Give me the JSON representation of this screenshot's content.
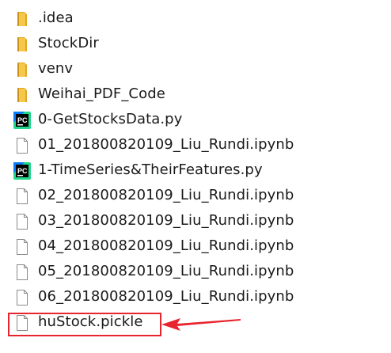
{
  "files": [
    {
      "name": ".idea",
      "type": "folder",
      "icon": "folder-icon"
    },
    {
      "name": "StockDir",
      "type": "folder",
      "icon": "folder-icon"
    },
    {
      "name": "venv",
      "type": "folder",
      "icon": "folder-icon"
    },
    {
      "name": "Weihai_PDF_Code",
      "type": "folder",
      "icon": "folder-icon"
    },
    {
      "name": "0-GetStocksData.py",
      "type": "python",
      "icon": "pycharm-icon"
    },
    {
      "name": "01_201800820109_Liu_Rundi.ipynb",
      "type": "file",
      "icon": "file-icon"
    },
    {
      "name": "1-TimeSeries&TheirFeatures.py",
      "type": "python",
      "icon": "pycharm-icon"
    },
    {
      "name": "02_201800820109_Liu_Rundi.ipynb",
      "type": "file",
      "icon": "file-icon"
    },
    {
      "name": "03_201800820109_Liu_Rundi.ipynb",
      "type": "file",
      "icon": "file-icon"
    },
    {
      "name": "04_201800820109_Liu_Rundi.ipynb",
      "type": "file",
      "icon": "file-icon"
    },
    {
      "name": "05_201800820109_Liu_Rundi.ipynb",
      "type": "file",
      "icon": "file-icon"
    },
    {
      "name": "06_201800820109_Liu_Rundi.ipynb",
      "type": "file",
      "icon": "file-icon"
    },
    {
      "name": "huStock.pickle",
      "type": "file",
      "icon": "file-icon"
    }
  ],
  "pycharm_badge": "PC",
  "colors": {
    "folder": "#f5c74a",
    "folder_dark": "#e0a92a",
    "pycharm_green": "#21d789",
    "pycharm_blue": "#087cfa",
    "highlight": "#e8252e"
  }
}
